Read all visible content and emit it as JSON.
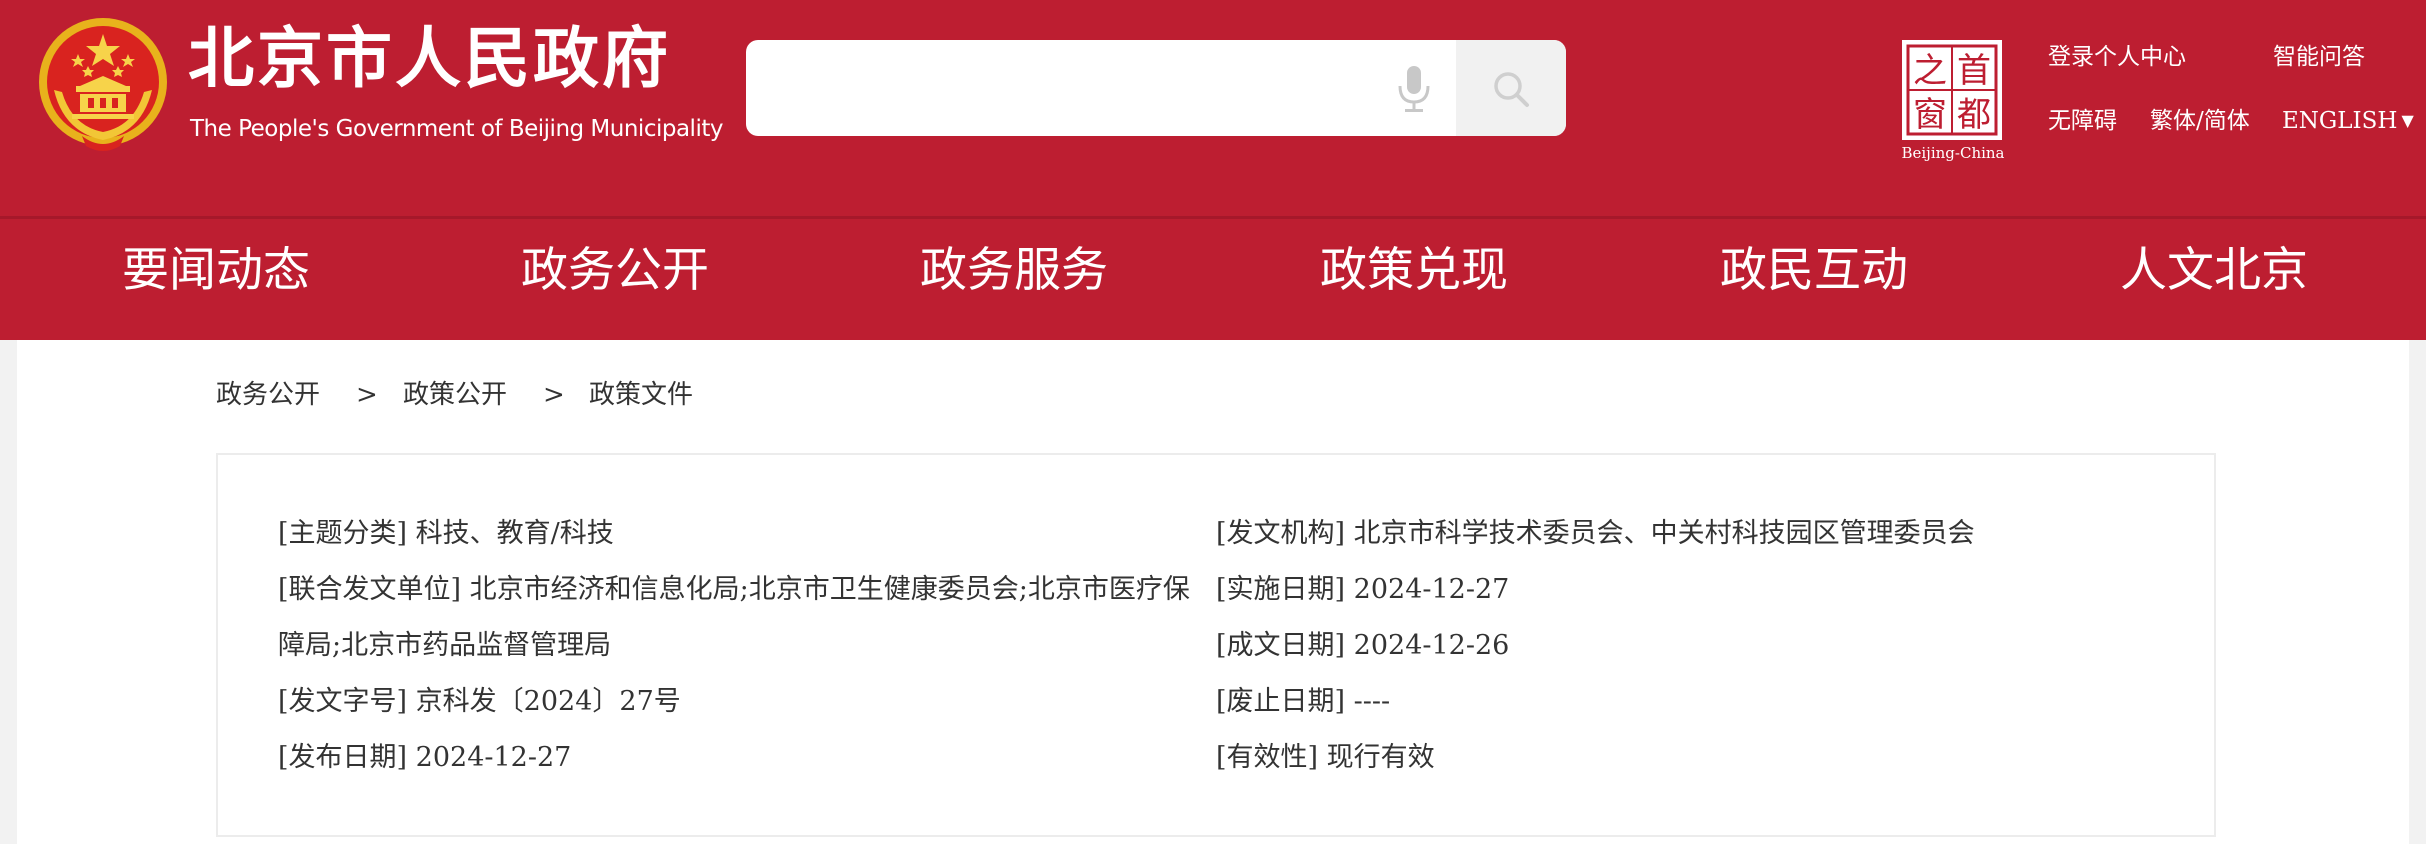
{
  "header": {
    "title_cn": "北京市人民政府",
    "title_en": "The People's Government of Beijing Municipality",
    "search": {
      "value": "",
      "placeholder": ""
    },
    "capital_logo_text": [
      "首",
      "都",
      "之",
      "窗"
    ],
    "capital_logo_caption": "Beijing-China",
    "links": {
      "login": "登录个人中心",
      "ai_qa": "智能问答",
      "accessibility": "无障碍",
      "script_toggle": "繁体/简体",
      "english": "ENGLISH",
      "english_arrow": "▼"
    },
    "colors": {
      "brand_red": "#bd1e31",
      "white": "#ffffff"
    }
  },
  "nav": {
    "items": [
      "要闻动态",
      "政务公开",
      "政务服务",
      "政策兑现",
      "政民互动",
      "人文北京"
    ]
  },
  "breadcrumb": {
    "items": [
      "政务公开",
      "政策公开",
      "政策文件"
    ],
    "separator": ">"
  },
  "document_info": {
    "left": [
      {
        "label": "[主题分类]",
        "value": "科技、教育/科技"
      },
      {
        "label": "[联合发文单位]",
        "value": "北京市经济和信息化局;北京市卫生健康委员会;北京市医疗保"
      },
      {
        "label": "",
        "value": "障局;北京市药品监督管理局"
      },
      {
        "label": "[发文字号]",
        "value": "京科发〔2024〕27号"
      },
      {
        "label": "[发布日期]",
        "value": "2024-12-27"
      }
    ],
    "right": [
      {
        "label": "[发文机构]",
        "value": "北京市科学技术委员会、中关村科技园区管理委员会"
      },
      {
        "label": "[实施日期]",
        "value": "2024-12-27"
      },
      {
        "label": "[成文日期]",
        "value": "2024-12-26"
      },
      {
        "label": "[废止日期]",
        "value": "----"
      },
      {
        "label": "[有效性]",
        "value": "现行有效"
      }
    ]
  }
}
